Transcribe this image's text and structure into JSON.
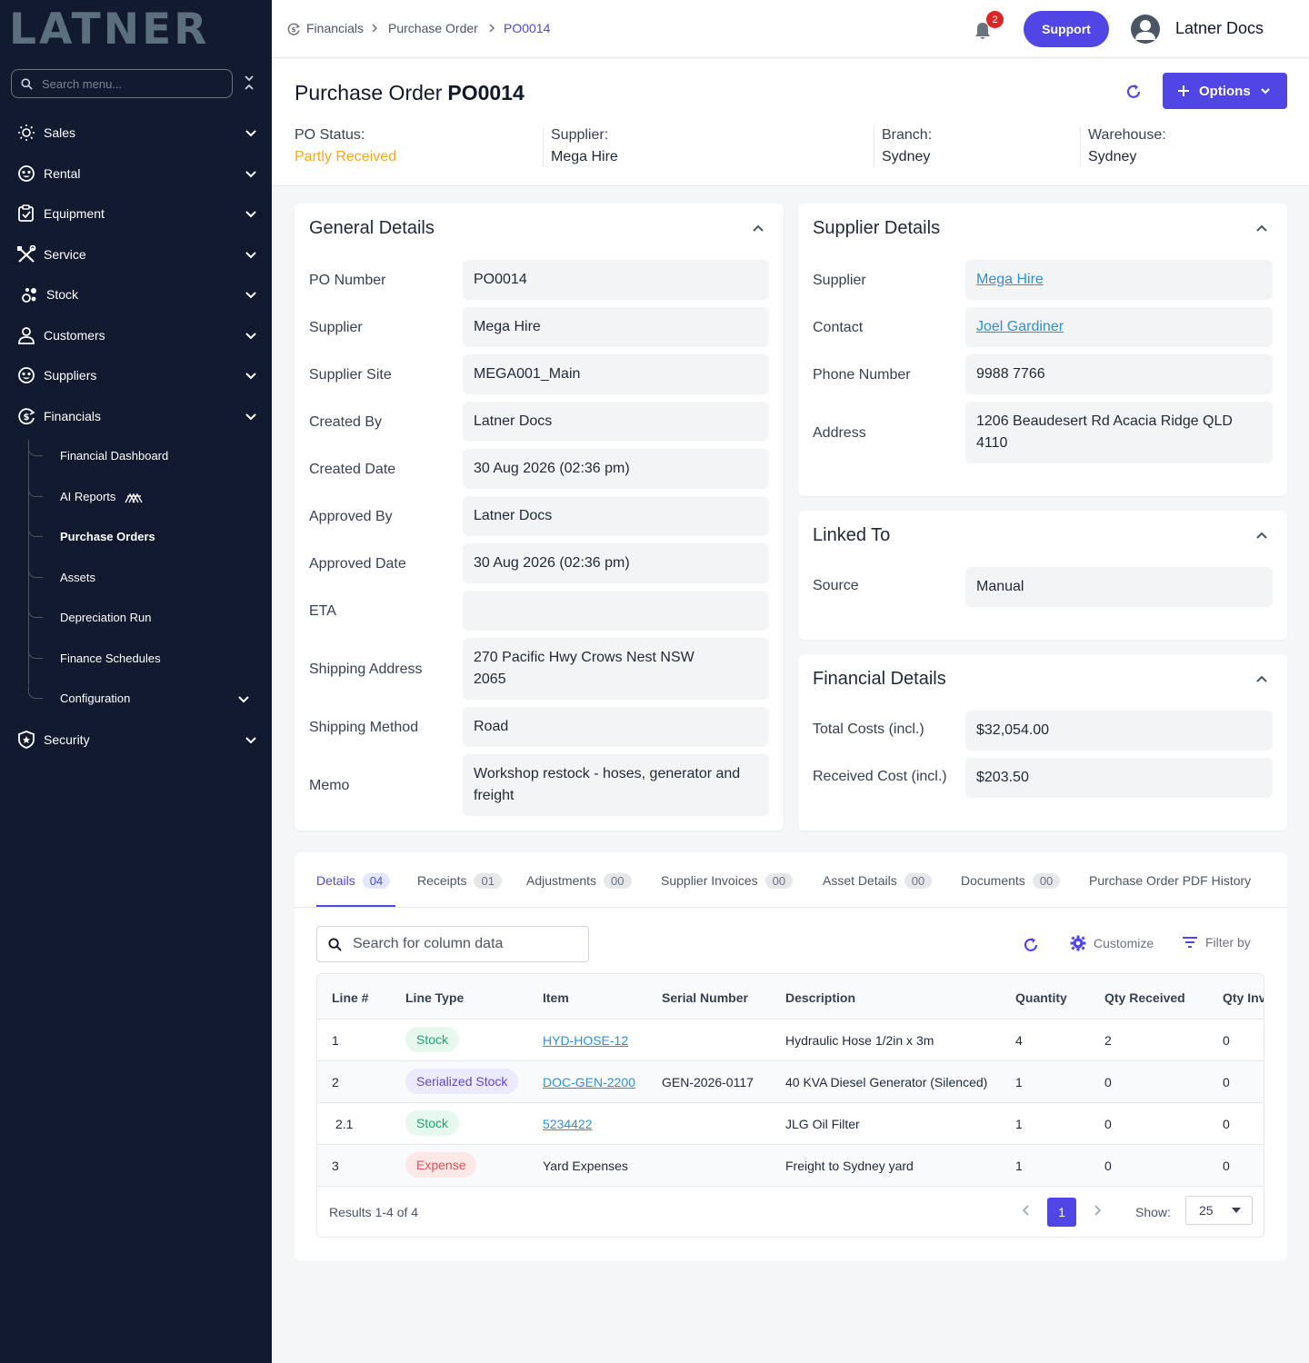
{
  "sidebar": {
    "logo": "LATNER",
    "search_placeholder": "Search menu...",
    "items": [
      {
        "label": "Sales",
        "icon": "sales-icon"
      },
      {
        "label": "Rental",
        "icon": "rental-icon"
      },
      {
        "label": "Equipment",
        "icon": "equipment-icon"
      },
      {
        "label": "Service",
        "icon": "service-icon"
      },
      {
        "label": "Stock",
        "icon": "stock-icon"
      },
      {
        "label": "Customers",
        "icon": "customers-icon"
      },
      {
        "label": "Suppliers",
        "icon": "suppliers-icon"
      },
      {
        "label": "Financials",
        "icon": "financials-icon"
      },
      {
        "label": "Security",
        "icon": "security-icon"
      }
    ],
    "financials_sub": [
      {
        "label": "Financial Dashboard"
      },
      {
        "label": "AI Reports"
      },
      {
        "label": "Purchase Orders"
      },
      {
        "label": "Assets"
      },
      {
        "label": "Depreciation Run"
      },
      {
        "label": "Finance Schedules"
      },
      {
        "label": "Configuration"
      }
    ]
  },
  "header": {
    "breadcrumb": [
      "Financials",
      "Purchase Order",
      "PO0014"
    ],
    "notification_count": "2",
    "support_label": "Support",
    "user_name": "Latner Docs"
  },
  "page": {
    "title_prefix": "Purchase Order",
    "title_id": "PO0014",
    "options_label": "Options",
    "summary": [
      {
        "label": "PO Status:",
        "value": "Partly Received",
        "color": "#f5a623"
      },
      {
        "label": "Supplier:",
        "value": "Mega Hire"
      },
      {
        "label": "Branch:",
        "value": "Sydney"
      },
      {
        "label": "Warehouse:",
        "value": "Sydney"
      }
    ]
  },
  "general_details": {
    "title": "General Details",
    "fields": [
      {
        "label": "PO Number",
        "value": "PO0014"
      },
      {
        "label": "Supplier",
        "value": "Mega Hire"
      },
      {
        "label": "Supplier Site",
        "value": "MEGA001_Main"
      },
      {
        "label": "Created By",
        "value": "Latner Docs"
      },
      {
        "label": "Created Date",
        "value": "30 Aug 2026 (02:36 pm)"
      },
      {
        "label": "Approved By",
        "value": "Latner Docs"
      },
      {
        "label": "Approved Date",
        "value": "30 Aug 2026 (02:36 pm)"
      },
      {
        "label": "ETA",
        "value": ""
      },
      {
        "label": "Shipping Address",
        "value": "270 Pacific Hwy Crows Nest NSW 2065"
      },
      {
        "label": "Shipping Method",
        "value": "Road"
      },
      {
        "label": "Memo",
        "value": "Workshop restock - hoses, generator and freight"
      }
    ]
  },
  "supplier_details": {
    "title": "Supplier Details",
    "fields": [
      {
        "label": "Supplier",
        "value": "Mega Hire"
      },
      {
        "label": "Contact",
        "value": "Joel Gardiner"
      },
      {
        "label": "Phone Number",
        "value": "9988 7766"
      },
      {
        "label": "Address",
        "value": "1206 Beaudesert Rd Acacia Ridge QLD 4110"
      }
    ]
  },
  "linked_to": {
    "title": "Linked To",
    "fields": [
      {
        "label": "Source",
        "value": "Manual"
      }
    ]
  },
  "financial_details": {
    "title": "Financial Details",
    "fields": [
      {
        "label": "Total Costs (incl.)",
        "value": "$32,054.00"
      },
      {
        "label": "Received Cost (incl.)",
        "value": "$203.50"
      }
    ]
  },
  "tabs": [
    {
      "label": "Details",
      "count": "04"
    },
    {
      "label": "Receipts",
      "count": "01"
    },
    {
      "label": "Adjustments",
      "count": "00"
    },
    {
      "label": "Supplier Invoices",
      "count": "00"
    },
    {
      "label": "Asset Details",
      "count": "00"
    },
    {
      "label": "Documents",
      "count": "00"
    },
    {
      "label": "Purchase Order PDF History",
      "count": ""
    }
  ],
  "table": {
    "search_placeholder": "Search for column data",
    "customize_label": "Customize",
    "filter_label": "Filter by",
    "columns": [
      "Line #",
      "Line Type",
      "Item",
      "Serial Number",
      "Description",
      "Quantity",
      "Qty Received",
      "Qty Inv"
    ],
    "rows": [
      {
        "line": "1",
        "type": "Stock",
        "item": "HYD-HOSE-12",
        "serial": "",
        "description": "Hydraulic Hose 1/2in x 3m",
        "qty": "4",
        "received": "2",
        "invoiced": "0"
      },
      {
        "line": "2",
        "type": "Serialized Stock",
        "item": "DOC-GEN-2200",
        "serial": "GEN-2026-0117",
        "description": "40 KVA Diesel Generator (Silenced)",
        "qty": "1",
        "received": "0",
        "invoiced": "0"
      },
      {
        "line": "2.1",
        "type": "Stock",
        "item": "5234422",
        "serial": "",
        "description": "JLG Oil Filter",
        "qty": "1",
        "received": "0",
        "invoiced": "0"
      },
      {
        "line": "3",
        "type": "Expense",
        "item": "Yard Expenses",
        "serial": "",
        "description": "Freight to Sydney yard",
        "qty": "1",
        "received": "0",
        "invoiced": "0"
      }
    ],
    "results_text": "Results 1-4 of 4",
    "current_page": "1",
    "show_label": "Show:",
    "page_size": "25"
  },
  "colors": {
    "accent": "#4f46e5",
    "sidebar_bg": "#111a2e",
    "status_partly_received": "#f5a623",
    "link": "#2e8fd6"
  }
}
